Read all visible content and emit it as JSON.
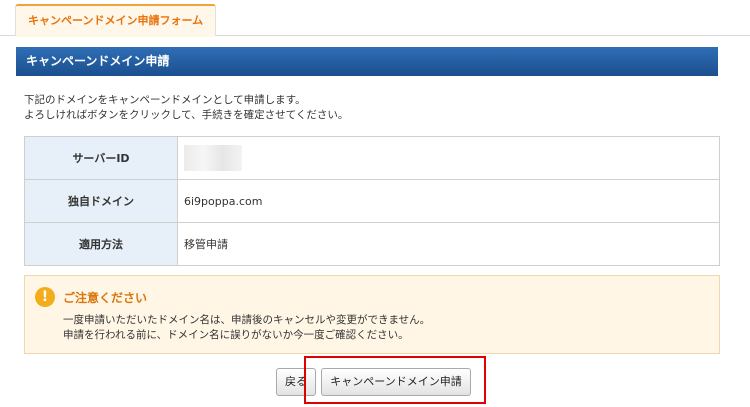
{
  "tab": {
    "label": "キャンペーンドメイン申請フォーム"
  },
  "header": {
    "title": "キャンペーンドメイン申請"
  },
  "intro": {
    "line1": "下記のドメインをキャンペーンドメインとして申請します。",
    "line2": "よろしければボタンをクリックして、手続きを確定させてください。"
  },
  "table": {
    "rows": [
      {
        "label": "サーバーID",
        "value": ""
      },
      {
        "label": "独自ドメイン",
        "value": "6i9poppa.com"
      },
      {
        "label": "適用方法",
        "value": "移管申請"
      }
    ]
  },
  "notice": {
    "icon": "exclamation-icon",
    "title": "ご注意ください",
    "line1": "一度申請いただいたドメイン名は、申請後のキャンセルや変更ができません。",
    "line2": "申請を行われる前に、ドメイン名に誤りがないか今一度ご確認ください。"
  },
  "buttons": {
    "back": "戻る",
    "apply": "キャンペーンドメイン申請"
  },
  "colors": {
    "accent": "#f0a33a",
    "header": "#1b4f8f",
    "highlight": "#e00000"
  }
}
